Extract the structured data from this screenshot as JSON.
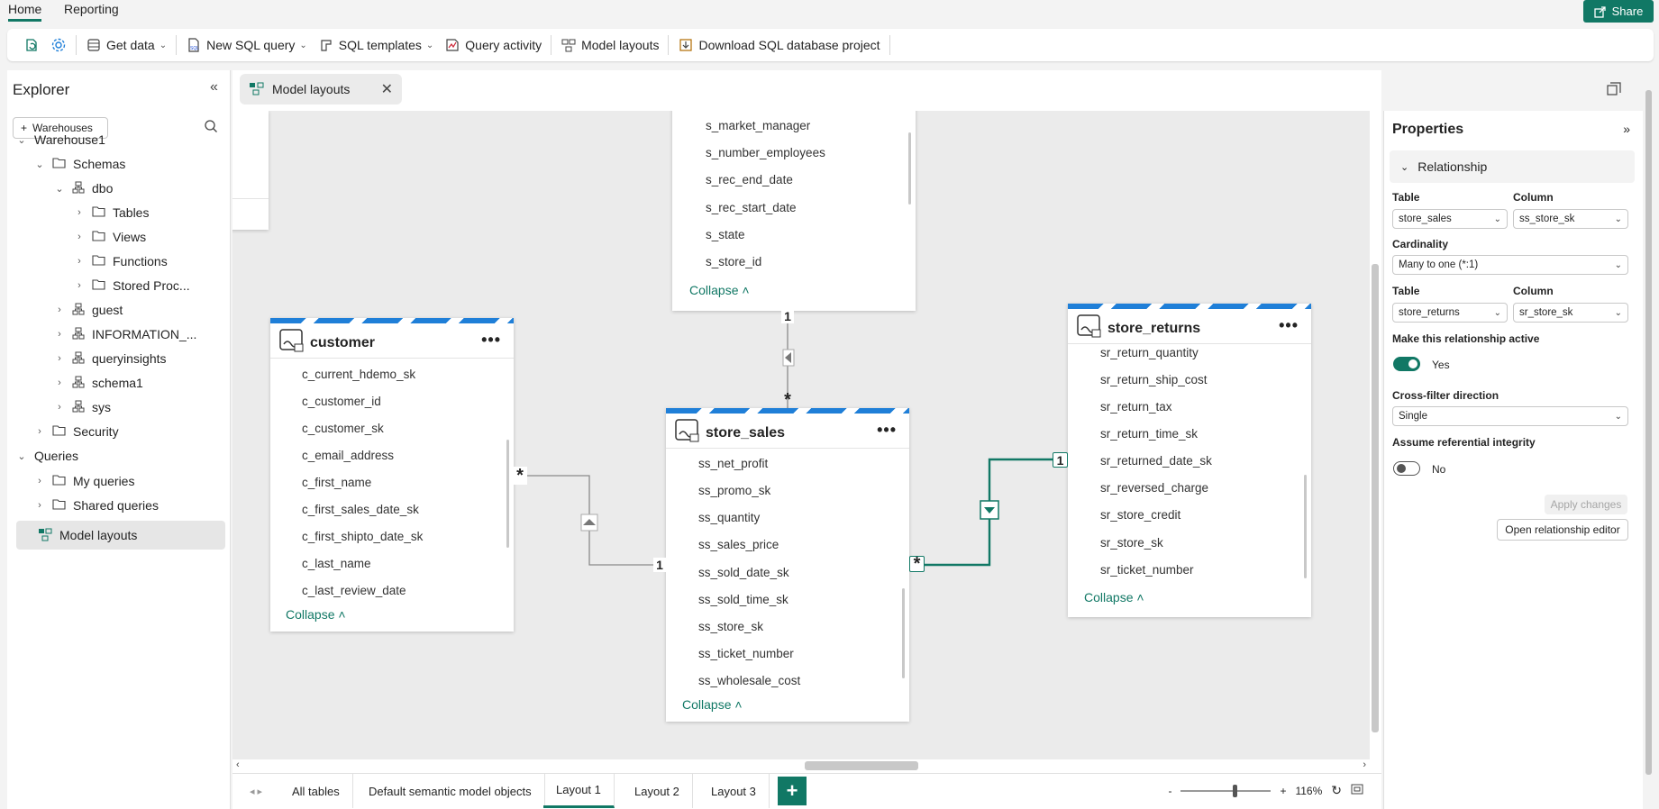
{
  "top_tabs": [
    {
      "label": "Home"
    },
    {
      "label": "Reporting"
    }
  ],
  "share_label": "Share",
  "toolbar": {
    "get_data": "Get data",
    "new_sql_query": "New SQL query",
    "sql_templates": "SQL templates",
    "query_activity": "Query activity",
    "model_layouts": "Model layouts",
    "download_project": "Download SQL database project"
  },
  "explorer": {
    "title": "Explorer",
    "warehouses_button": "Warehouses",
    "tree": {
      "warehouse1": "Warehouse1",
      "schemas": "Schemas",
      "dbo": "dbo",
      "tables": "Tables",
      "views": "Views",
      "functions": "Functions",
      "stored_procs": "Stored Proc...",
      "guest": "guest",
      "information_schema": "INFORMATION_...",
      "queryinsights": "queryinsights",
      "schema1": "schema1",
      "sys": "sys",
      "security": "Security",
      "queries": "Queries",
      "my_queries": "My queries",
      "shared_queries": "Shared queries",
      "model_layouts": "Model layouts"
    }
  },
  "document_tab": {
    "label": "Model layouts"
  },
  "cards": {
    "store_top": {
      "columns": [
        "s_market_manager",
        "s_number_employees",
        "s_rec_end_date",
        "s_rec_start_date",
        "s_state",
        "s_store_id"
      ],
      "collapse": "Collapse"
    },
    "customer": {
      "title": "customer",
      "columns": [
        "c_current_hdemo_sk",
        "c_customer_id",
        "c_customer_sk",
        "c_email_address",
        "c_first_name",
        "c_first_sales_date_sk",
        "c_first_shipto_date_sk",
        "c_last_name",
        "c_last_review_date"
      ],
      "collapse": "Collapse"
    },
    "store_sales": {
      "title": "store_sales",
      "columns": [
        "ss_net_profit",
        "ss_promo_sk",
        "ss_quantity",
        "ss_sales_price",
        "ss_sold_date_sk",
        "ss_sold_time_sk",
        "ss_store_sk",
        "ss_ticket_number",
        "ss_wholesale_cost"
      ],
      "collapse": "Collapse"
    },
    "store_returns": {
      "title": "store_returns",
      "columns": [
        "sr_return_quantity",
        "sr_return_ship_cost",
        "sr_return_tax",
        "sr_return_time_sk",
        "sr_returned_date_sk",
        "sr_reversed_charge",
        "sr_store_credit",
        "sr_store_sk",
        "sr_ticket_number"
      ],
      "collapse": "Collapse"
    }
  },
  "relationship_labels": {
    "store_one": "1",
    "store_many": "*",
    "customer_many": "*",
    "customer_one": "1",
    "returns_one": "1",
    "returns_many": "*"
  },
  "bottom_tabs": [
    {
      "label": "All tables"
    },
    {
      "label": "Default semantic model objects"
    },
    {
      "label": "Layout 1"
    },
    {
      "label": "Layout 2"
    },
    {
      "label": "Layout 3"
    }
  ],
  "zoom": {
    "minus": "-",
    "plus": "+",
    "value": "116%"
  },
  "properties": {
    "title": "Properties",
    "section": "Relationship",
    "table_label_1": "Table",
    "column_label_1": "Column",
    "table_value_1": "store_sales",
    "column_value_1": "ss_store_sk",
    "cardinality_label": "Cardinality",
    "cardinality_value": "Many to one (*:1)",
    "table_label_2": "Table",
    "column_label_2": "Column",
    "table_value_2": "store_returns",
    "column_value_2": "sr_store_sk",
    "active_label": "Make this relationship active",
    "active_value": "Yes",
    "crossfilter_label": "Cross-filter direction",
    "crossfilter_value": "Single",
    "integrity_label": "Assume referential integrity",
    "integrity_value": "No",
    "apply_button": "Apply changes",
    "open_editor_button": "Open relationship editor"
  },
  "colors": {
    "accent": "#117865",
    "stripe": "#1f7fd8"
  }
}
